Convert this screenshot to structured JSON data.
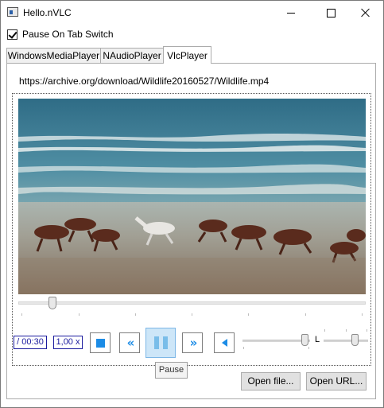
{
  "window": {
    "title": "Hello.nVLC"
  },
  "options": {
    "pause_on_tab_switch": {
      "label": "Pause On Tab Switch",
      "checked": true
    }
  },
  "tabs": [
    {
      "label": "WindowsMediaPlayer",
      "active": false
    },
    {
      "label": "NAudioPlayer",
      "active": false
    },
    {
      "label": "VlcPlayer",
      "active": true
    }
  ],
  "player": {
    "url": "https://archive.org/download/Wildlife20160527/Wildlife.mp4",
    "video_description": "horses running on beach",
    "seek_position": 0.09,
    "time_label": "/ 00:30",
    "rate_label": "1,00 x",
    "volume_level": 0.93,
    "balance_label": "L",
    "balance_level": 0.72,
    "pause_tooltip": "Pause",
    "accent_color": "#1c8ce6"
  },
  "buttons": {
    "open_file": "Open file...",
    "open_url": "Open URL..."
  },
  "icons": {
    "app": "app-window-icon",
    "minimize": "minimize-icon",
    "maximize": "maximize-icon",
    "close": "close-icon",
    "stop": "stop-icon",
    "rewind": "rewind-icon",
    "pause": "pause-icon",
    "forward": "fast-forward-icon",
    "volume": "volume-icon"
  }
}
